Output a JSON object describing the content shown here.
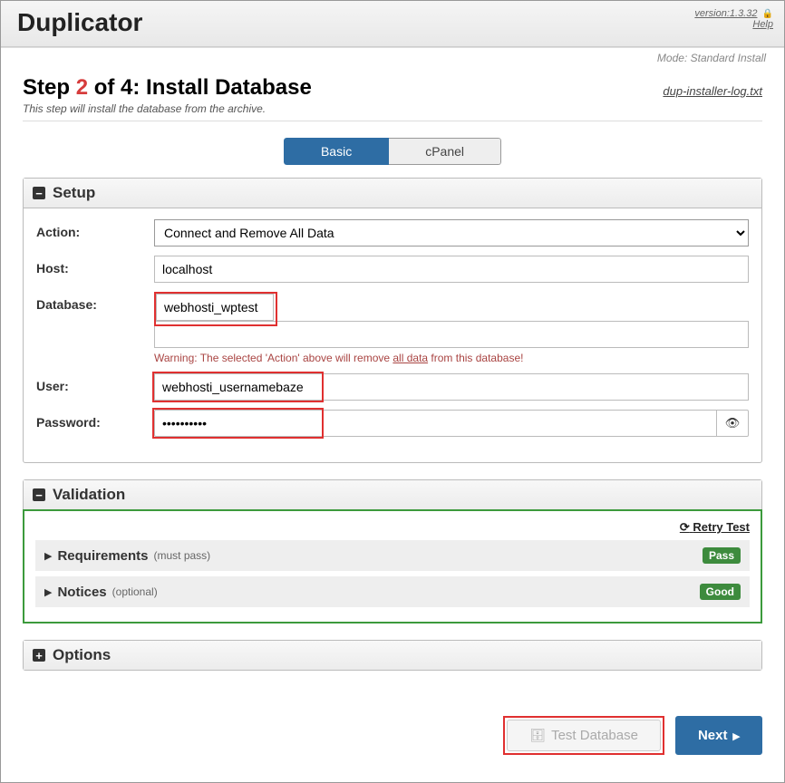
{
  "header": {
    "brand": "Duplicator",
    "version": "version:1.3.32",
    "help": "Help",
    "mode": "Mode: Standard Install"
  },
  "step": {
    "prefix": "Step ",
    "num": "2",
    "suffix": " of 4: Install Database",
    "sub": "This step will install the database from the archive.",
    "log_link": "dup-installer-log.txt"
  },
  "tabs": {
    "basic": "Basic",
    "cpanel": "cPanel"
  },
  "setup": {
    "title": "Setup",
    "action_label": "Action:",
    "action_value": "Connect and Remove All Data",
    "host_label": "Host:",
    "host_value": "localhost",
    "db_label": "Database:",
    "db_value": "webhosti_wptest",
    "db_warning_pre": "Warning: The selected 'Action' above will remove ",
    "db_warning_link": "all data",
    "db_warning_post": " from this database!",
    "user_label": "User:",
    "user_value": "webhosti_usernamebaze",
    "pwd_label": "Password:",
    "pwd_value": "••••••••••"
  },
  "validation": {
    "title": "Validation",
    "retry": "Retry Test",
    "req_title": "Requirements",
    "req_note": "(must pass)",
    "req_badge": "Pass",
    "not_title": "Notices",
    "not_note": "(optional)",
    "not_badge": "Good"
  },
  "options": {
    "title": "Options"
  },
  "footer": {
    "test": "Test Database",
    "next": "Next"
  }
}
